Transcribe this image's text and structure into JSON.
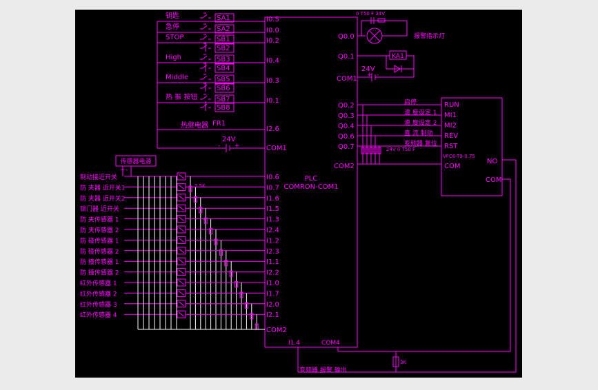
{
  "palette": {
    "background": "#ebebeb",
    "drawing_bg": "#000000",
    "line": "#ff00ff",
    "bus": "#ffffff"
  },
  "top_inputs": [
    {
      "name": "钥匙",
      "tag": "SA1",
      "port": "I0.5"
    },
    {
      "name": "急停",
      "tag": "SA2",
      "port": "I0.0"
    },
    {
      "name": "STOP",
      "tag": "SB1",
      "port": "I0.2"
    },
    {
      "name": "",
      "tag": "SB2",
      "port": ""
    },
    {
      "name": "High",
      "tag": "SB3",
      "port": "I0.4"
    },
    {
      "name": "",
      "tag": "SB4",
      "port": ""
    },
    {
      "name": "Middle",
      "tag": "SB5",
      "port": "I0.3"
    },
    {
      "name": "",
      "tag": "SB6",
      "port": ""
    },
    {
      "name": "热 振 按钮",
      "tag": "SB7",
      "port": "I0.1"
    },
    {
      "name": "",
      "tag": "SB8",
      "port": ""
    }
  ],
  "relay": {
    "name": "热继电器",
    "tag": "FR1",
    "port": "I2.6"
  },
  "top_supply": {
    "voltage": "24V",
    "plus": "+",
    "minus": "-",
    "port": "COM1"
  },
  "sensor_power_label": "传感器电源",
  "sensors": [
    {
      "label": "制动接近开关",
      "port": "I0.6"
    },
    {
      "label": "防 夹器 近开关1",
      "port": "I0.7"
    },
    {
      "label": "防 夹器 近开关2",
      "port": "I1.6"
    },
    {
      "label": "锁门器 近开关",
      "port": "I1.5"
    },
    {
      "label": "防 夹传感器 1",
      "port": "I1.3"
    },
    {
      "label": "防 夹传感器 2",
      "port": "I2.4"
    },
    {
      "label": "防 碰传感器 1",
      "port": "I1.2"
    },
    {
      "label": "防 碰传感器 2",
      "port": "I2.3"
    },
    {
      "label": "防 撞传感器 1",
      "port": "I1.1"
    },
    {
      "label": "防 撞传感器 2",
      "port": "I2.2"
    },
    {
      "label": "红外传感器 1",
      "port": "I1.0"
    },
    {
      "label": "红外传感器 2",
      "port": "I1.7"
    },
    {
      "label": "红外传感器 3",
      "port": "I2.0"
    },
    {
      "label": "红外传感器 4",
      "port": "I2.1"
    }
  ],
  "sensor_resistor": "2.5K",
  "sensor_com": "COM2",
  "plc": {
    "title": "PLC",
    "model": "COMRON-COM1",
    "bottom_left": "I1.4",
    "bottom_right": "COM4"
  },
  "outputs_top": {
    "q0": "Q0.0",
    "q1": "Q0.1",
    "com": "COM1",
    "lamp_label": "报警指示灯",
    "relay_tag": "KA1",
    "voltage": "24V",
    "plus": "+",
    "minus": "-",
    "cap_note": "0 T50 F 24V"
  },
  "inverter_outputs": [
    {
      "port": "Q0.2",
      "label": "启停",
      "term": "RUN"
    },
    {
      "port": "Q0.3",
      "label": "速 度设定 1",
      "term": "MI1"
    },
    {
      "port": "Q0.4",
      "label": "速 度设定 2",
      "term": "MI2"
    },
    {
      "port": "Q0.6",
      "label": "直 流 制动",
      "term": "REV"
    },
    {
      "port": "Q0.7",
      "label": "变频器 复位",
      "term": "RST"
    }
  ],
  "inverter": {
    "model": "VFC6-T9-0.75",
    "com": "COM",
    "no": "NO",
    "com2": "COM"
  },
  "output_com2": "COM2",
  "cap_note2": "24V 0 T50 F",
  "bottom": {
    "resistor": "3K",
    "caption": "变频器 报警 输出"
  }
}
